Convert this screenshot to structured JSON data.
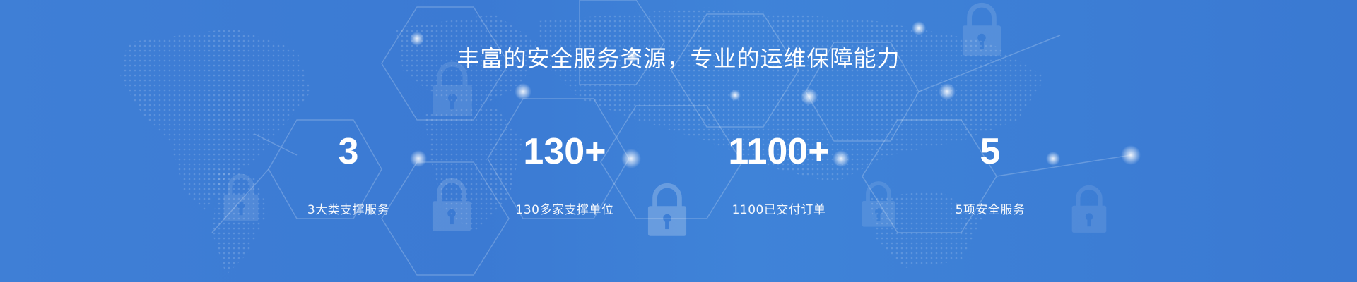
{
  "banner": {
    "headline": "丰富的安全服务资源，专业的运维保障能力",
    "background_color": "#3b7ad3",
    "background_icons": [
      "lock-icon",
      "hexagon-network",
      "world-map-dots"
    ],
    "stats": [
      {
        "number": "3",
        "label": "3大类支撑服务"
      },
      {
        "number": "130+",
        "label": "130多家支撑单位"
      },
      {
        "number": "1100+",
        "label": "1100已交付订单"
      },
      {
        "number": "5",
        "label": "5项安全服务"
      }
    ]
  }
}
